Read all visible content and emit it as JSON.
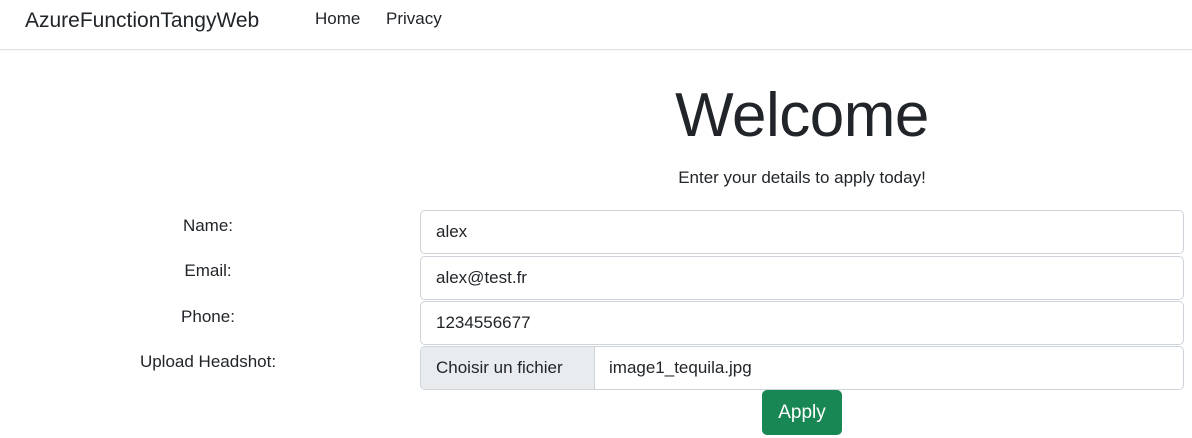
{
  "navbar": {
    "brand": "AzureFunctionTangyWeb",
    "links": [
      "Home",
      "Privacy"
    ]
  },
  "main": {
    "title": "Welcome",
    "subtitle": "Enter your details to apply today!"
  },
  "form": {
    "name": {
      "label": "Name:",
      "value": "alex"
    },
    "email": {
      "label": "Email:",
      "value": "alex@test.fr"
    },
    "phone": {
      "label": "Phone:",
      "value": "1234556677"
    },
    "upload": {
      "label": "Upload Headshot:",
      "button_label": "Choisir un fichier",
      "file_name": "image1_tequila.jpg"
    },
    "submit_label": "Apply"
  },
  "colors": {
    "accent": "#198754",
    "border": "#ced4da",
    "file_button_bg": "#e9ecef"
  }
}
